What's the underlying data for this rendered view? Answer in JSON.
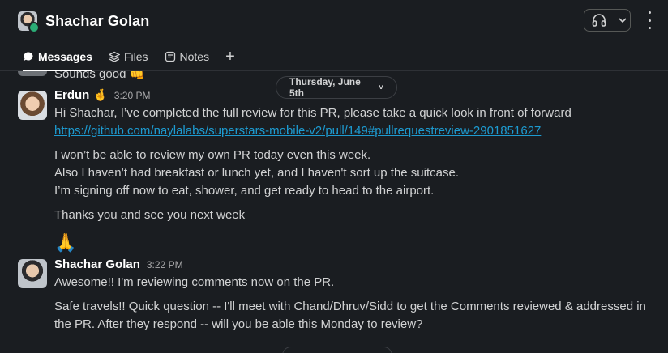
{
  "header": {
    "title": "Shachar Golan",
    "avatar_icon": "user-avatar",
    "presence_color": "#2bac76",
    "huddle_icon": "headphones-icon",
    "huddle_dropdown_icon": "chevron-down-icon",
    "more_icon": "kebab-menu-icon"
  },
  "tabs": [
    {
      "label": "Messages",
      "icon": "message-bubble-icon",
      "active": true
    },
    {
      "label": "Files",
      "icon": "layers-icon",
      "active": false
    },
    {
      "label": "Notes",
      "icon": "note-icon",
      "active": false
    }
  ],
  "tab_add_label": "+",
  "previous_message": {
    "text": "Sounds good",
    "emoji": "👊"
  },
  "date_divider": {
    "label": "Thursday, June 5th",
    "chevron": "˅"
  },
  "messages": [
    {
      "author": "Erdun",
      "status_emoji": "🤞",
      "time": "3:20 PM",
      "lines": [
        "Hi Shachar, I’ve completed the full review for this PR, please take a quick look in front of forward"
      ],
      "link": "https://github.com/naylalabs/superstars-mobile-v2/pull/149#pullrequestreview-2901851627",
      "paragraph2": [
        "I won’t be able to review my own PR today even this week.",
        "Also I haven’t had breakfast or lunch yet, and I haven't sort up the suitcase.",
        "I’m signing off now to eat, shower, and get ready to head to the airport."
      ],
      "paragraph3": "Thanks you and see you next week",
      "emoji_line": "🙏"
    },
    {
      "author": "Shachar Golan",
      "time": "3:22 PM",
      "line1": "Awesome!! I'm reviewing comments now on the PR.",
      "paragraph2_line1": "Safe travels!! Quick question -- I'll meet with Chand/Dhruv/Sidd to get the Comments reviewed & addressed in",
      "paragraph2_line2": "the PR. After they respond -- will you be able this Monday to review?"
    }
  ],
  "colors": {
    "background": "#1a1d21",
    "link": "#1d9bd1",
    "text": "#d1d2d3",
    "muted": "#ababad"
  }
}
